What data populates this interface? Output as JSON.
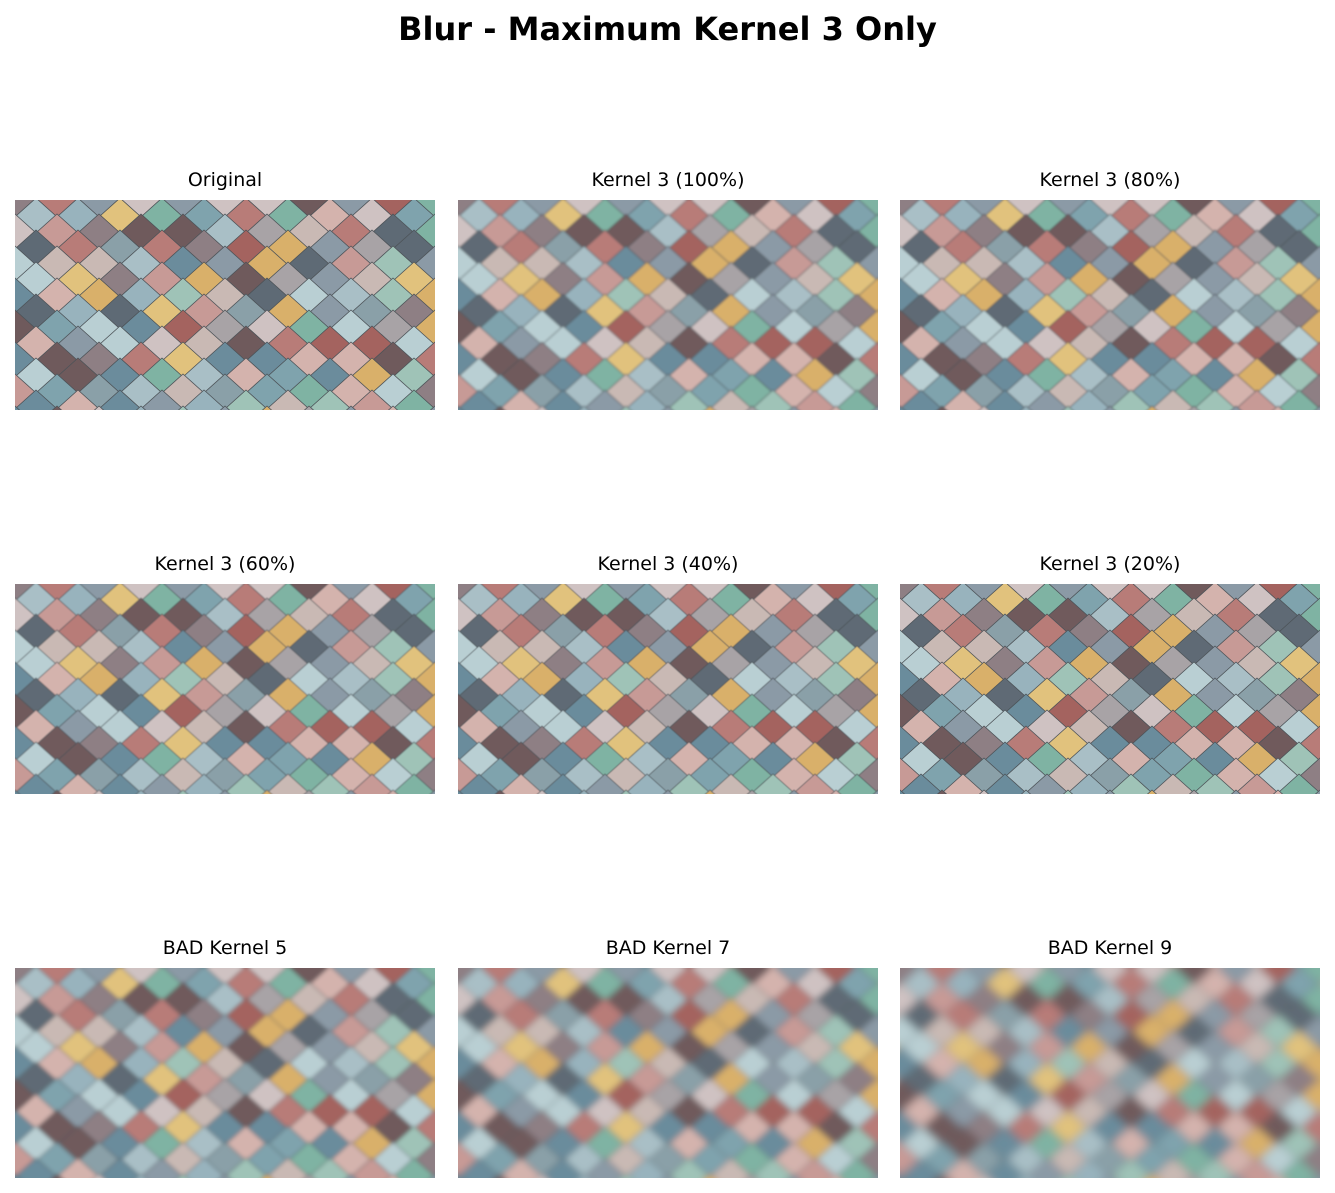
{
  "figure": {
    "title": "Blur - Maximum Kernel 3 Only"
  },
  "panels": [
    {
      "title": "Original",
      "blur": 0
    },
    {
      "title": "Kernel 3 (100%)",
      "blur": 1.3
    },
    {
      "title": "Kernel 3 (80%)",
      "blur": 1.1
    },
    {
      "title": "Kernel 3 (60%)",
      "blur": 0.85
    },
    {
      "title": "Kernel 3 (40%)",
      "blur": 0.6
    },
    {
      "title": "Kernel 3 (20%)",
      "blur": 0.3
    },
    {
      "title": "BAD Kernel 5",
      "blur": 2.2
    },
    {
      "title": "BAD Kernel 7",
      "blur": 3.4
    },
    {
      "title": "BAD Kernel 9",
      "blur": 4.8
    }
  ]
}
